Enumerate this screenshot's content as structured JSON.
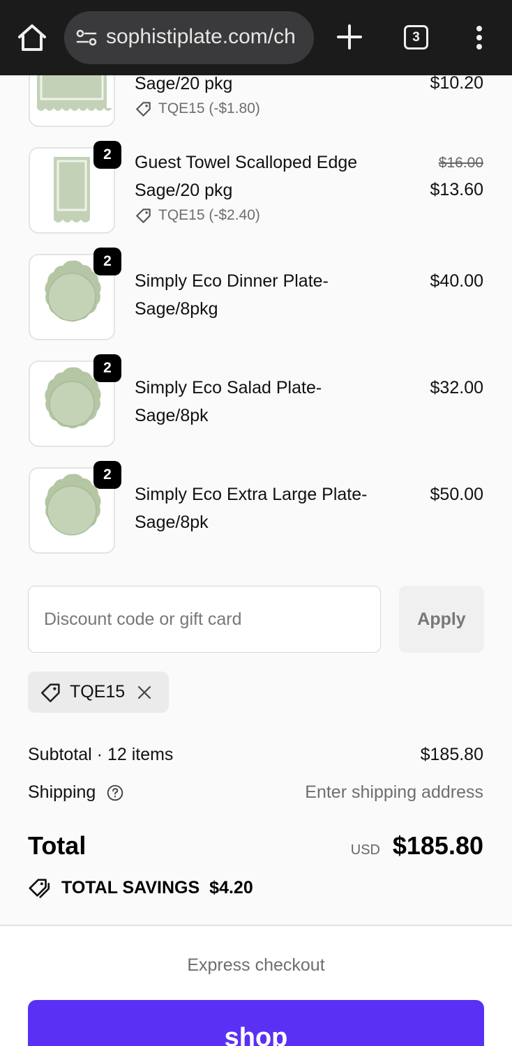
{
  "browser": {
    "url": "sophistiplate.com/ch",
    "tab_count": "3",
    "icons": [
      "home-icon",
      "site-settings-icon",
      "new-tab-icon",
      "tab-switcher-icon",
      "more-menu-icon"
    ]
  },
  "items": [
    {
      "name_line2": "Sage/20 pkg",
      "price": "$10.20",
      "discount": "TQE15 (-$1.80)"
    },
    {
      "qty": "2",
      "name": "Guest Towel Scalloped Edge Sage/20 pkg",
      "price_old": "$16.00",
      "price": "$13.60",
      "discount": "TQE15 (-$2.40)"
    },
    {
      "qty": "2",
      "name": "Simply Eco Dinner Plate-Sage/8pkg",
      "price": "$40.00"
    },
    {
      "qty": "2",
      "name": "Simply Eco Salad Plate-Sage/8pk",
      "price": "$32.00"
    },
    {
      "qty": "2",
      "name": "Simply Eco Extra Large Plate-Sage/8pk",
      "price": "$50.00"
    }
  ],
  "discount": {
    "placeholder": "Discount code or gift card",
    "apply_label": "Apply",
    "applied_code": "TQE15"
  },
  "summary": {
    "subtotal_label": "Subtotal · 12 items",
    "subtotal_value": "$185.80",
    "shipping_label": "Shipping",
    "shipping_value": "Enter shipping address",
    "total_label": "Total",
    "currency": "USD",
    "total_value": "$185.80",
    "savings_label": "TOTAL SAVINGS",
    "savings_value": "$4.20"
  },
  "footer": {
    "express_label": "Express checkout",
    "shop_label": "shop"
  },
  "colors": {
    "shop_purple": "#5a31f4",
    "sage": "#b7c9a8",
    "browser_bar": "#1b1b1c"
  }
}
